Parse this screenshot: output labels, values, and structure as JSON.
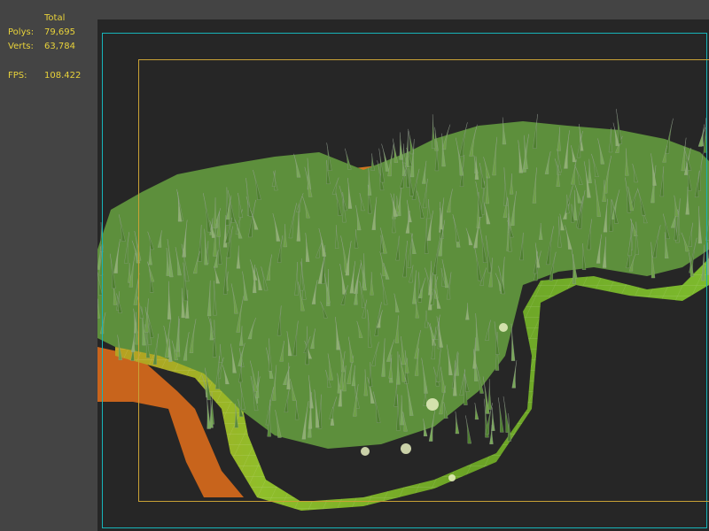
{
  "stats": {
    "total_label": "Total",
    "polys_label": "Polys:",
    "polys_value": "79,695",
    "verts_label": "Verts:",
    "verts_value": "63,784",
    "fps_label": "FPS:",
    "fps_value": "108.422"
  },
  "colors": {
    "stats_text": "#e8d23a",
    "sidebar_bg": "#444444",
    "viewport_bg": "#262626",
    "viewport_frame": "#17b4b9",
    "safe_frame": "#c9a235",
    "grass": "#5d8f3c",
    "ground_green": "#7fb22c",
    "ground_orange": "#c8641c"
  },
  "viewport": {
    "content_icon": "grass-mesh-wireframe"
  }
}
